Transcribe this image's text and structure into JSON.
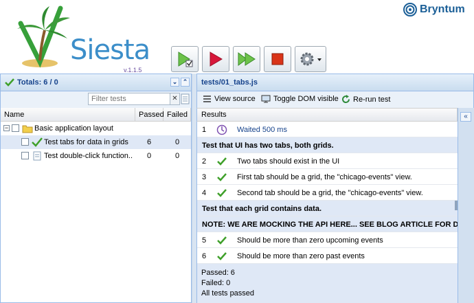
{
  "header": {
    "logo_title": "Siesta",
    "version": "v.1.1.5",
    "brand": "Bryntum"
  },
  "toolbar": {
    "buttons": [
      "run-checked",
      "run-failed",
      "run-all",
      "stop",
      "options"
    ]
  },
  "left_panel": {
    "title": "Totals: 6 / 0",
    "filter_placeholder": "Filter tests",
    "filter_clear": "✕",
    "columns": {
      "name": "Name",
      "passed": "Passed",
      "failed": "Failed"
    },
    "group": {
      "name": "Basic application layout"
    },
    "tests": [
      {
        "name": "Test tabs for data in grids",
        "passed": "6",
        "failed": "0",
        "status": "passed"
      },
      {
        "name": "Test double-click function...",
        "passed": "0",
        "failed": "0",
        "status": "pending"
      }
    ]
  },
  "right_panel": {
    "title": "tests/01_tabs.js",
    "actions": {
      "view_source": "View source",
      "toggle_dom": "Toggle DOM visible",
      "rerun": "Re-run test"
    },
    "results_header": "Results",
    "rows": [
      {
        "num": "1",
        "kind": "wait",
        "text": "Waited 500 ms"
      },
      {
        "num": "",
        "kind": "section",
        "text": "Test that UI has two tabs, both grids."
      },
      {
        "num": "2",
        "kind": "pass",
        "text": "Two tabs should exist in the UI"
      },
      {
        "num": "3",
        "kind": "pass",
        "text": "First tab should be a grid, the \"chicago-events\" view."
      },
      {
        "num": "4",
        "kind": "pass",
        "text": "Second tab should be a grid, the \"chicago-events\" view."
      },
      {
        "num": "",
        "kind": "section",
        "text": "Test that each grid contains data."
      },
      {
        "num": "",
        "kind": "section",
        "text": "NOTE: WE ARE MOCKING THE API HERE... SEE BLOG ARTICLE FOR DETAILS"
      },
      {
        "num": "5",
        "kind": "pass",
        "text": "Should be more than zero upcoming events"
      },
      {
        "num": "6",
        "kind": "pass",
        "text": "Should be more than zero past events"
      }
    ],
    "summary": {
      "passed": "Passed: 6",
      "failed": "Failed: 0",
      "status": "All tests passed"
    },
    "expand_label": "«"
  },
  "colors": {
    "accent": "#15428b",
    "panel_border": "#99bbe8",
    "pass_green": "#3fa02a",
    "run_red": "#d7183a",
    "stop_red": "#d93418"
  }
}
